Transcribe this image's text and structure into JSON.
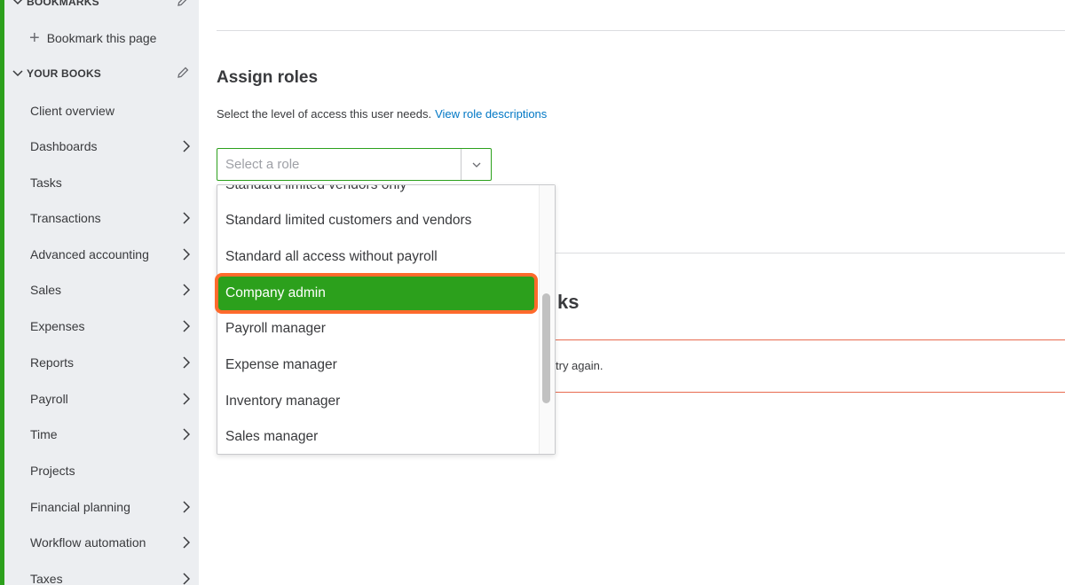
{
  "sidebar": {
    "bookmarks_header": "BOOKMARKS",
    "bookmark_action": "Bookmark this page",
    "books_header": "YOUR BOOKS",
    "items": [
      {
        "label": "Client overview"
      },
      {
        "label": "Dashboards"
      },
      {
        "label": "Tasks"
      },
      {
        "label": "Transactions"
      },
      {
        "label": "Advanced accounting"
      },
      {
        "label": "Sales"
      },
      {
        "label": "Expenses"
      },
      {
        "label": "Reports"
      },
      {
        "label": "Payroll"
      },
      {
        "label": "Time"
      },
      {
        "label": "Projects"
      },
      {
        "label": "Financial planning"
      },
      {
        "label": "Workflow automation"
      },
      {
        "label": "Taxes"
      }
    ]
  },
  "main": {
    "title": "Assign roles",
    "description": "Select the level of access this user needs.",
    "description_link": "View role descriptions",
    "select_placeholder": "Select a role",
    "behind_heading_fragment": "ks",
    "behind_alert_fragment": "try again."
  },
  "dropdown": {
    "options": [
      {
        "label": "Standard limited vendors only"
      },
      {
        "label": "Standard limited customers and vendors"
      },
      {
        "label": "Standard all access without payroll"
      },
      {
        "label": "Company admin"
      },
      {
        "label": "Payroll manager"
      },
      {
        "label": "Expense manager"
      },
      {
        "label": "Inventory manager"
      },
      {
        "label": "Sales manager"
      }
    ],
    "selected_index": 3
  },
  "colors": {
    "accent_green": "#2ca01c",
    "highlight_orange": "#ff6a2c",
    "link_blue": "#0077c5",
    "alert_red": "#e86b50"
  }
}
